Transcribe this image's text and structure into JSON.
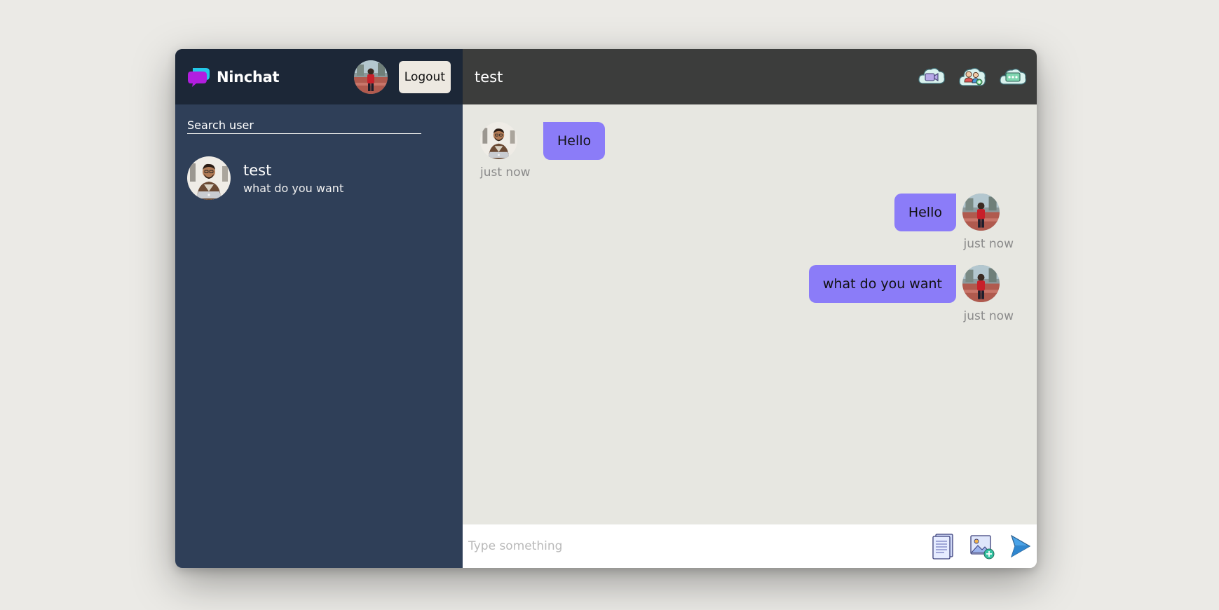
{
  "app": {
    "name": "Ninchat"
  },
  "navbar": {
    "logout_label": "Logout"
  },
  "search": {
    "placeholder": "Search user"
  },
  "contacts": [
    {
      "name": "test",
      "last_message": "what do you want"
    }
  ],
  "chat": {
    "title": "test",
    "header_icons": [
      "video-call-icon",
      "add-friend-icon",
      "more-options-icon"
    ],
    "messages": [
      {
        "direction": "incoming",
        "text": "Hello",
        "time": "just now"
      },
      {
        "direction": "outgoing",
        "text": "Hello",
        "time": "just now"
      },
      {
        "direction": "outgoing",
        "text": "what do you want",
        "time": "just now"
      }
    ],
    "input_placeholder": "Type something",
    "input_icons": [
      "attach-file-icon",
      "add-image-icon",
      "send-icon"
    ]
  },
  "colors": {
    "sidebar_bg": "#2f3f58",
    "navbar_bg": "#1c2737",
    "chat_header_bg": "#3c3d3c",
    "chat_bg": "#e7e7e1",
    "bubble": "#8b7cf8",
    "page_bg": "#ebeae6"
  }
}
